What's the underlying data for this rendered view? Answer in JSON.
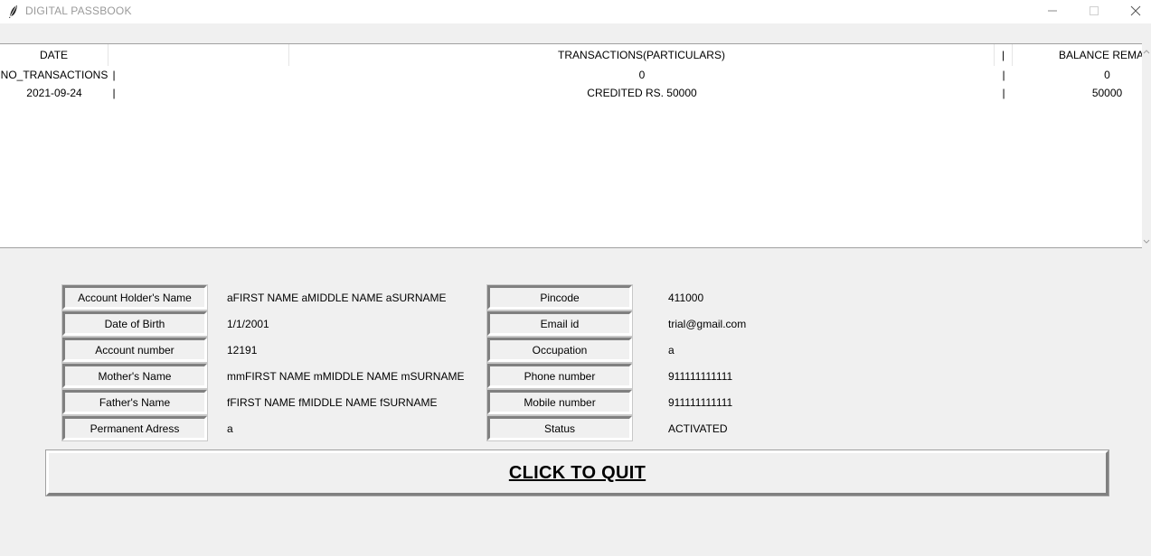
{
  "window": {
    "title": "DIGITAL PASSBOOK",
    "controls": [
      "minimize-icon",
      "maximize-icon",
      "close-icon"
    ]
  },
  "table": {
    "headers": {
      "date": "DATE",
      "sep1": "",
      "transactions": "TRANSACTIONS(PARTICULARS)",
      "sep2": "|",
      "balance": "BALANCE REMAI"
    },
    "rows": [
      {
        "date": "NO_TRANSACTIONS",
        "sep1": "|",
        "particulars": "0",
        "sep2": "|",
        "balance": "0"
      },
      {
        "date": "2021-09-24",
        "sep1": "|",
        "particulars": "CREDITED RS. 50000",
        "sep2": "|",
        "balance": "50000"
      }
    ]
  },
  "details": {
    "left": [
      {
        "label": "Account Holder's Name",
        "value": "aFIRST NAME aMIDDLE NAME aSURNAME"
      },
      {
        "label": "Date of Birth",
        "value": "1/1/2001"
      },
      {
        "label": "Account number",
        "value": "12191"
      },
      {
        "label": "Mother's Name",
        "value": "mmFIRST NAME mMIDDLE NAME mSURNAME"
      },
      {
        "label": "Father's Name",
        "value": "fFIRST NAME fMIDDLE NAME fSURNAME"
      },
      {
        "label": "Permanent Adress",
        "value": "a"
      }
    ],
    "right": [
      {
        "label": "Pincode",
        "value": "411000"
      },
      {
        "label": "Email id",
        "value": "trial@gmail.com"
      },
      {
        "label": "Occupation",
        "value": "a"
      },
      {
        "label": "Phone number",
        "value": "911111111111"
      },
      {
        "label": "Mobile number",
        "value": "911111111111"
      },
      {
        "label": "Status",
        "value": "ACTIVATED"
      }
    ]
  },
  "quit_button": {
    "label": "CLICK TO QUIT"
  },
  "colors": {
    "background": "#f0f0f0",
    "table_background": "#ffffff",
    "bevel_dark": "#808080",
    "bevel_light": "#ffffff",
    "title_text": "#9a9a9a"
  }
}
